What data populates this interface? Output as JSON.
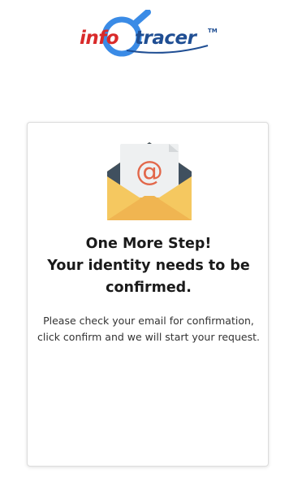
{
  "logo": {
    "part1": "info",
    "part2": "tracer",
    "trademark": "TM",
    "colors": {
      "info": "#d92a2a",
      "tracer": "#1f4e93",
      "magnifier": "#3a8be6"
    }
  },
  "confirmation": {
    "icon": "envelope-email-icon",
    "heading_line1": "One More Step!",
    "heading_line2": "Your identity needs to be",
    "heading_line3": "confirmed.",
    "message": "Please check your email for confirmation, click confirm and we will start your request."
  }
}
